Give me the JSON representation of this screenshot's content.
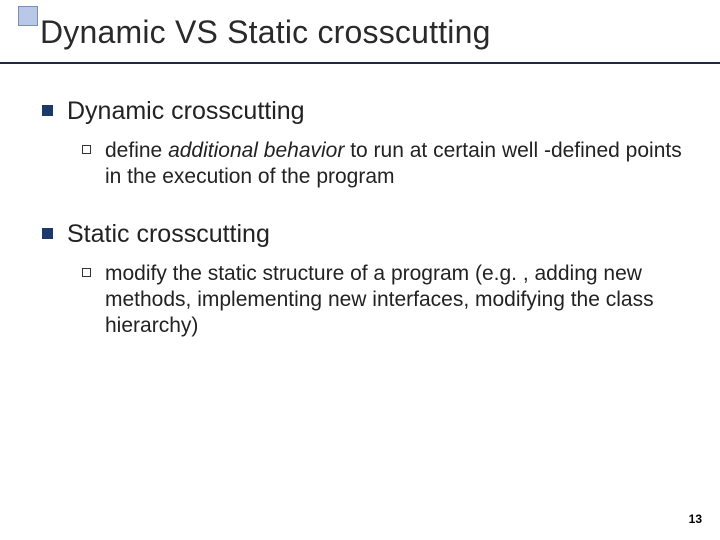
{
  "title": "Dynamic VS Static crosscutting",
  "sections": [
    {
      "heading": "Dynamic crosscutting",
      "sub": {
        "prefix": "define ",
        "italic": "additional behavior",
        "suffix": " to run at certain well -defined points in the execution of the program"
      }
    },
    {
      "heading": "Static crosscutting",
      "sub": {
        "prefix": "modify the static structure of a program (e.g. , adding new methods, implementing new interfaces, modifying the class hierarchy)",
        "italic": "",
        "suffix": ""
      }
    }
  ],
  "page_number": "13"
}
